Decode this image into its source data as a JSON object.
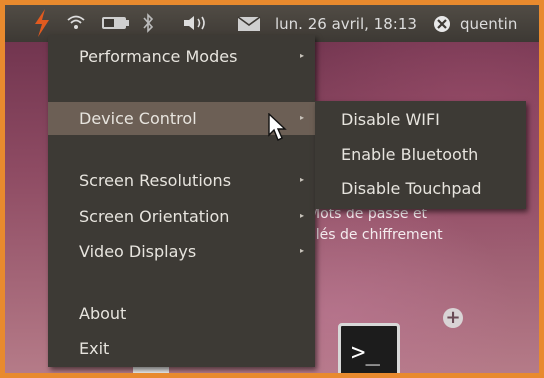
{
  "panel": {
    "icons": [
      "bolt-icon",
      "wifi-icon",
      "battery-icon",
      "bluetooth-icon",
      "volume-icon",
      "mail-icon"
    ],
    "clock": "lun. 26 avril, 18:13",
    "user": "quentin",
    "accent_color": "#e05a1f"
  },
  "desktop": {
    "text_line1": "Mots de passe et",
    "text_line2": "clés de chiffrement",
    "terminal_prompt": ">_"
  },
  "menu": {
    "items": [
      {
        "label": "Performance Modes",
        "has_submenu": true
      },
      {
        "label": "Device Control",
        "has_submenu": true,
        "highlighted": true
      },
      {
        "label": "Screen Resolutions",
        "has_submenu": true
      },
      {
        "label": "Screen Orientation",
        "has_submenu": true
      },
      {
        "label": "Video Displays",
        "has_submenu": true
      },
      {
        "label": "About",
        "has_submenu": false
      },
      {
        "label": "Exit",
        "has_submenu": false
      }
    ],
    "submenu_arrow": "▸"
  },
  "submenu": {
    "items": [
      {
        "label": "Disable WIFI"
      },
      {
        "label": "Enable Bluetooth"
      },
      {
        "label": "Disable Touchpad"
      }
    ]
  }
}
